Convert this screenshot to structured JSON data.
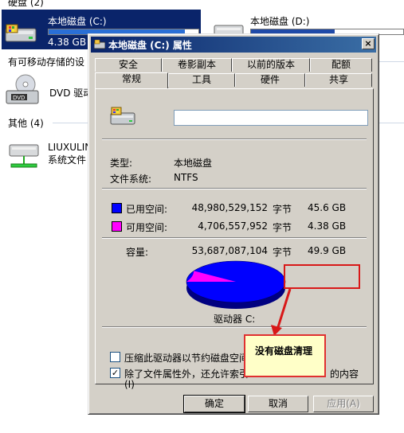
{
  "explorer": {
    "hard_disk_group": "硬盘 (2)",
    "drive_c": {
      "name": "本地磁盘 (C:)",
      "size_text": "4.38 GB"
    },
    "drive_d": {
      "name": "本地磁盘 (D:)"
    },
    "removable_group": "有可移动存储的设",
    "dvd_label": "DVD 驱动",
    "other_group": "其他 (4)",
    "other_item_line1": "LIUXULIN-",
    "other_item_line2": "系统文件"
  },
  "dialog": {
    "title": "本地磁盘 (C:) 属性",
    "close_label": "×",
    "tabs_row1": [
      "安全",
      "卷影副本",
      "以前的版本",
      "配额"
    ],
    "tabs_row2": [
      "常规",
      "工具",
      "硬件",
      "共享"
    ],
    "name_value": "",
    "type_label": "类型:",
    "type_value": "本地磁盘",
    "fs_label": "文件系统:",
    "fs_value": "NTFS",
    "used_label": "已用空间:",
    "used_bytes": "48,980,529,152",
    "used_unit": "字节",
    "used_gb": "45.6 GB",
    "free_label": "可用空间:",
    "free_bytes": "4,706,557,952",
    "free_unit": "字节",
    "free_gb": "4.38 GB",
    "capacity_label": "容量:",
    "capacity_bytes": "53,687,087,104",
    "capacity_unit": "字节",
    "capacity_gb": "49.9 GB",
    "drive_label": "驱动器 C:",
    "compress_label": "压缩此驱动器以节约磁盘空间(C)",
    "index_label_line1": "除了文件属性外，还允许索引",
    "index_label_tail": "的内容",
    "index_label_line2": "(I)",
    "compress_checked": false,
    "index_checked": true,
    "ok_label": "确定",
    "cancel_label": "取消",
    "apply_label": "应用(A)",
    "used_color": "#0000ff",
    "free_color": "#ff00ff",
    "used_fraction": 0.912
  },
  "annotation": {
    "callout_text": "没有磁盘清理",
    "color": "#d81818"
  }
}
